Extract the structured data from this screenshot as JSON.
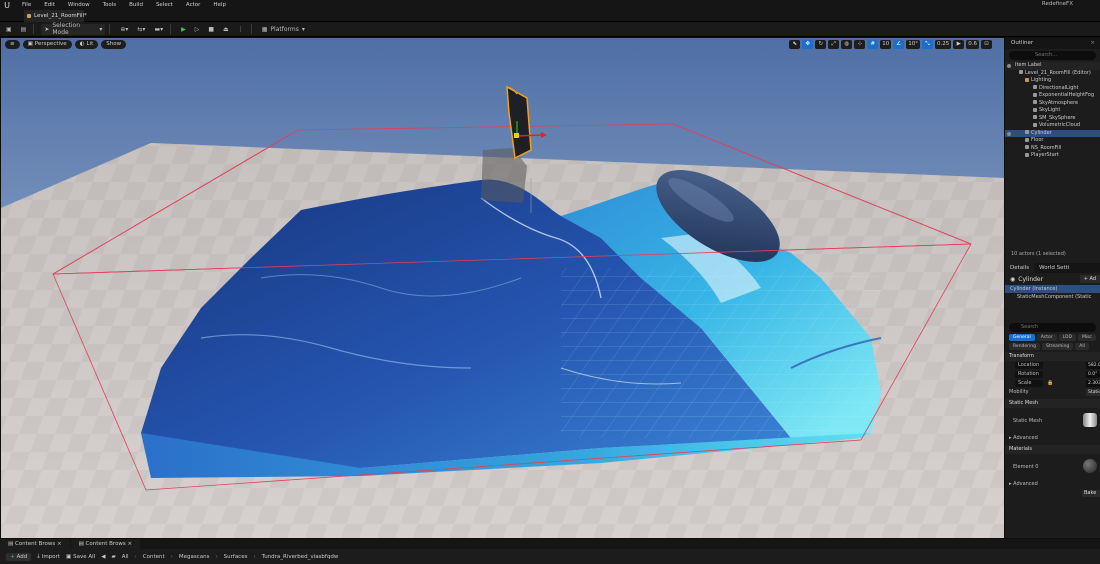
{
  "menu": {
    "logo": "U",
    "items": [
      "File",
      "Edit",
      "Window",
      "Tools",
      "Build",
      "Select",
      "Actor",
      "Help"
    ],
    "brand": "RedefineFX"
  },
  "level_tab": {
    "label": "Level_21_RoomFill*"
  },
  "toolbar": {
    "selection_mode": "Selection Mode",
    "platforms": "Platforms"
  },
  "viewport": {
    "view_mode": "Perspective",
    "lit": "Lit",
    "show": "Show",
    "snap_grid": "10",
    "snap_angle": "10°",
    "snap_scale": "0.25",
    "camera_speed": "0.6"
  },
  "outliner": {
    "title": "Outliner",
    "search_placeholder": "Search...",
    "column": "Item Label",
    "items": [
      {
        "label": "Level_21_RoomFill (Editor)",
        "type": "world"
      },
      {
        "label": "Lighting",
        "type": "folder"
      },
      {
        "label": "DirectionalLight",
        "type": "actor"
      },
      {
        "label": "ExponentialHeightFog",
        "type": "actor"
      },
      {
        "label": "SkyAtmosphere",
        "type": "actor"
      },
      {
        "label": "SkyLight",
        "type": "actor"
      },
      {
        "label": "SM_SkySphere",
        "type": "actor"
      },
      {
        "label": "VolumetricCloud",
        "type": "actor"
      },
      {
        "label": "Cylinder",
        "type": "actor",
        "selected": true
      },
      {
        "label": "Floor",
        "type": "actor"
      },
      {
        "label": "NS_RoomFill",
        "type": "actor"
      },
      {
        "label": "PlayerStart",
        "type": "actor"
      }
    ],
    "status": "10 actors (1 selected)"
  },
  "details": {
    "tab_details": "Details",
    "tab_world": "World Setti",
    "actor_name": "Cylinder",
    "add_button": "Ad",
    "instance": "Cylinder (Instance)",
    "component": "StaticMeshComponent (Static",
    "search_placeholder": "Search",
    "filters": [
      "General",
      "Actor",
      "LOD",
      "Misc",
      "Rendering",
      "Streaming",
      "All"
    ],
    "transform": "Transform",
    "location_label": "Location",
    "location_value": "582.0",
    "rotation_label": "Rotation",
    "rotation_value": "0.0°",
    "scale_label": "Scale",
    "scale_value": "2.303",
    "mobility_label": "Mobility",
    "mobility_value": "Static",
    "static_mesh_section": "Static Mesh",
    "static_mesh_label": "Static Mesh",
    "advanced1": "Advanced",
    "materials_section": "Materials",
    "element_label": "Element 0",
    "advanced2": "Advanced",
    "bake_button": "Bake"
  },
  "drawers": [
    "Content Brows",
    "Content Brows"
  ],
  "content_bar": {
    "add": "Add",
    "import": "Import",
    "save_all": "Save All",
    "path": [
      "All",
      "Content",
      "Megascans",
      "Surfaces",
      "Tundra_Riverbed_viasbfqdw"
    ]
  },
  "colors": {
    "play_green": "#4cc14c",
    "accent_blue": "#1e6ec5",
    "selection": "#2d4f7d",
    "water_deep": "#1a3f8f",
    "water_shallow": "#38c6e8",
    "bounds_red": "#e0405a"
  }
}
